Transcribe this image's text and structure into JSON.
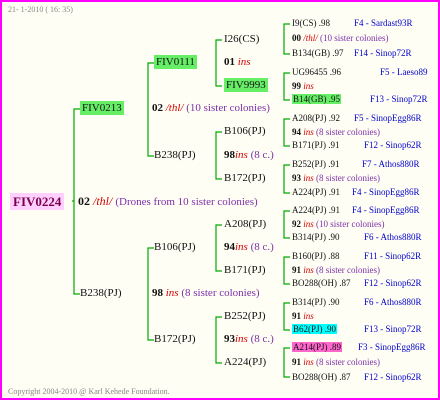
{
  "header": {
    "date": "21-  1-2010 ( 16: 35)"
  },
  "footer": {
    "copyright": "Copyright 2004-2010 @ Karl Kehede Foundation."
  },
  "colors": {
    "border": "#ff00ff",
    "lines": "#00aa00",
    "mate_blue": "#0000cc",
    "ins_red": "#d40000",
    "note_purple": "#7b2fa8"
  },
  "root": {
    "id": "FIV0224",
    "gen": "02",
    "ins": "/thl/",
    "note": "(Drones from 10 sister colonies)"
  },
  "gen1": {
    "top": {
      "id": "FIV0213",
      "gen": "02",
      "ins": "/thl/",
      "note": "(10 sister colonies)"
    },
    "bottom": {
      "id": "B238(PJ)",
      "gen": "98",
      "ins": "ins",
      "note": "(8 sister colonies)"
    }
  },
  "gen2": {
    "a": {
      "id": "FIV0111"
    },
    "b": {
      "id": "B238(PJ)",
      "gen": "98",
      "ins": "ins",
      "note": "(8 c.)"
    },
    "c": {
      "id": "B106(PJ)",
      "gen": "94",
      "ins": "ins",
      "note": "(8 c.)"
    },
    "d": {
      "id": "B172(PJ)",
      "gen": "93",
      "ins": "ins",
      "note": "(8 c.)"
    }
  },
  "gen3": {
    "a1": {
      "id": "I26(CS)",
      "gen": "01",
      "ins": "ins"
    },
    "a2": {
      "id": "FIV9993",
      "gen": "99",
      "ins": "ins"
    },
    "b1": {
      "id": "B106(PJ)",
      "gen": "94",
      "ins": "ins",
      "note": "(8 colonies)"
    },
    "b2": {
      "id": "B172(PJ)",
      "gen": "93",
      "ins": "ins",
      "note": "(8 colonies)"
    },
    "c1": {
      "id": "A208(PJ)",
      "gen": "92",
      "ins": "ins",
      "note": "(10 sister colonies)"
    },
    "c2": {
      "id": "B171(PJ)",
      "gen": "91",
      "ins": "ins",
      "note": "(8 sister colonies)"
    },
    "d1": {
      "id": "B252(PJ)",
      "gen": "91",
      "ins": "ins"
    },
    "d2": {
      "id": "A224(PJ)",
      "gen": "91",
      "ins": "ins"
    }
  },
  "gen4": {
    "r1": {
      "id": "I9(CS)",
      "year": ".98",
      "mate": "F4 - Sardast93R"
    },
    "r2": {
      "id": "B134(GB)",
      "year": ".97",
      "mate": "F14 - Sinop72R"
    },
    "r3": {
      "id": "UG96455",
      "year": ".96",
      "mate": "F5 - Laeso89"
    },
    "r4": {
      "id": "B14(GB)",
      "year": ".95",
      "mate": "F13 - Sinop72R"
    },
    "r5": {
      "id": "A208(PJ)",
      "year": ".92",
      "mate": "F5 - SinopEgg86R"
    },
    "r6": {
      "id": "B171(PJ)",
      "year": ".91",
      "mate": "F12 - Sinop62R"
    },
    "r7": {
      "id": "B252(PJ)",
      "year": ".91",
      "mate": "F7 - Athos880R"
    },
    "r8": {
      "id": "A224(PJ)",
      "year": ".91",
      "mate": "F4 - SinopEgg86R"
    },
    "r9": {
      "id": "A224(PJ)",
      "year": ".91",
      "mate": "F4 - SinopEgg86R"
    },
    "r10": {
      "id": "B314(PJ)",
      "year": ".90",
      "mate": "F6 - Athos880R"
    },
    "r11": {
      "id": "B160(PJ)",
      "year": ".88",
      "mate": "F11 - Sinop62R"
    },
    "r12": {
      "id": "BO288(OH)",
      "year": ".87",
      "mate": "F12 - Sinop62R"
    },
    "r13": {
      "id": "B314(PJ)",
      "year": ".90",
      "mate": "F6 - Athos880R"
    },
    "r14": {
      "id": "B62(PJ)",
      "year": ".90",
      "mate": "F13 - Sinop72R"
    },
    "r15": {
      "id": "A214(PJ)",
      "year": ".89",
      "mate": "F3 - SinopEgg86R"
    },
    "r16": {
      "id": "BO288(OH)",
      "year": ".87",
      "mate": "F12 - Sinop62R"
    }
  },
  "gen4_mid": {
    "m1": {
      "gen": "00",
      "ins": "/thl/",
      "note": "(10 sister colonies)"
    },
    "m2": {
      "gen": "99",
      "ins": "ins"
    },
    "m3": {
      "gen": "94",
      "ins": "ins",
      "note": "(8 sister colonies)"
    },
    "m4": {
      "gen": "93",
      "ins": "ins",
      "note": "(8 sister colonies)"
    },
    "m5": {
      "gen": "92",
      "ins": "ins",
      "note": "(10 sister colonies)"
    },
    "m6": {
      "gen": "91",
      "ins": "ins",
      "note": "(8 sister colonies)"
    },
    "m7": {
      "gen": "91",
      "ins": "ins"
    },
    "m8": {
      "gen": "91",
      "ins": "ins",
      "note": "(8 sister colonies)"
    }
  }
}
